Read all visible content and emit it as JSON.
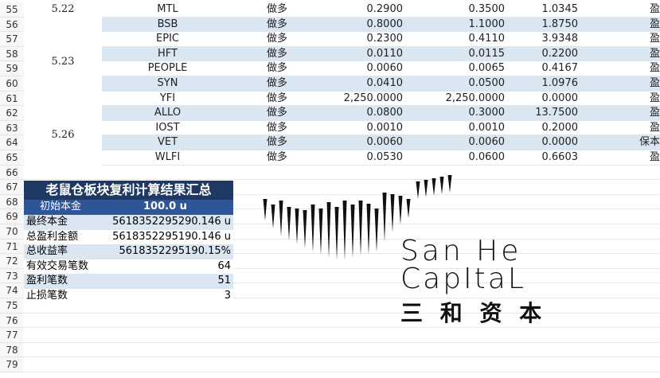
{
  "rows": [
    {
      "num": "55",
      "date": "5.22",
      "symbol": "MTL",
      "dir": "做多",
      "entry": "0.2900",
      "exit": "0.3500",
      "ratio": "1.0345",
      "result": "盈"
    },
    {
      "num": "56",
      "date": "",
      "symbol": "BSB",
      "dir": "做多",
      "entry": "0.8000",
      "exit": "1.1000",
      "ratio": "1.8750",
      "result": "盈"
    },
    {
      "num": "57",
      "date": "",
      "symbol": "EPIC",
      "dir": "做多",
      "entry": "0.2300",
      "exit": "0.4110",
      "ratio": "3.9348",
      "result": "盈"
    },
    {
      "num": "58",
      "date": "5.23",
      "symbol": "HFT",
      "dir": "做多",
      "entry": "0.0110",
      "exit": "0.0115",
      "ratio": "0.2200",
      "result": "盈"
    },
    {
      "num": "59",
      "date": "",
      "symbol": "PEOPLE",
      "dir": "做多",
      "entry": "0.0060",
      "exit": "0.0065",
      "ratio": "0.4167",
      "result": "盈"
    },
    {
      "num": "60",
      "date": "",
      "symbol": "SYN",
      "dir": "做多",
      "entry": "0.0410",
      "exit": "0.0500",
      "ratio": "1.0976",
      "result": "盈"
    },
    {
      "num": "61",
      "date": "",
      "symbol": "YFI",
      "dir": "做多",
      "entry": "2,250.0000",
      "exit": "2,250.0000",
      "ratio": "0.0000",
      "result": "盈"
    },
    {
      "num": "62",
      "date": "",
      "symbol": "ALLO",
      "dir": "做多",
      "entry": "0.0800",
      "exit": "0.3000",
      "ratio": "13.7500",
      "result": "盈"
    },
    {
      "num": "63",
      "date": "5.26",
      "symbol": "IOST",
      "dir": "做多",
      "entry": "0.0010",
      "exit": "0.0010",
      "ratio": "0.2000",
      "result": "盈"
    },
    {
      "num": "64",
      "date": "",
      "symbol": "VET",
      "dir": "做多",
      "entry": "0.0060",
      "exit": "0.0060",
      "ratio": "0.0000",
      "result": "保本"
    },
    {
      "num": "65",
      "date": "",
      "symbol": "WLFI",
      "dir": "做多",
      "entry": "0.0530",
      "exit": "0.0600",
      "ratio": "0.6603",
      "result": "盈"
    }
  ],
  "extra_rows": [
    "66",
    "67",
    "68",
    "69",
    "70",
    "71",
    "72",
    "73",
    "74",
    "75",
    "76",
    "77",
    "78",
    "79"
  ],
  "summary": {
    "title": "老鼠仓板块复利计算结果汇总",
    "initial_label": "初始本金",
    "initial_value": "100.0 u",
    "items": [
      {
        "label": "最终本金",
        "value": "5618352295290.146 u"
      },
      {
        "label": "总盈利金额",
        "value": "5618352295190.146 u"
      },
      {
        "label": "总收益率",
        "value": "5618352295190.15%"
      },
      {
        "label": "有效交易笔数",
        "value": "64"
      },
      {
        "label": "盈利笔数",
        "value": "51"
      },
      {
        "label": "止损笔数",
        "value": "3"
      }
    ]
  },
  "logo": {
    "line1": "San He",
    "line2": "CapItaL",
    "line3": "三 和 资 本",
    "color": "#111111"
  }
}
